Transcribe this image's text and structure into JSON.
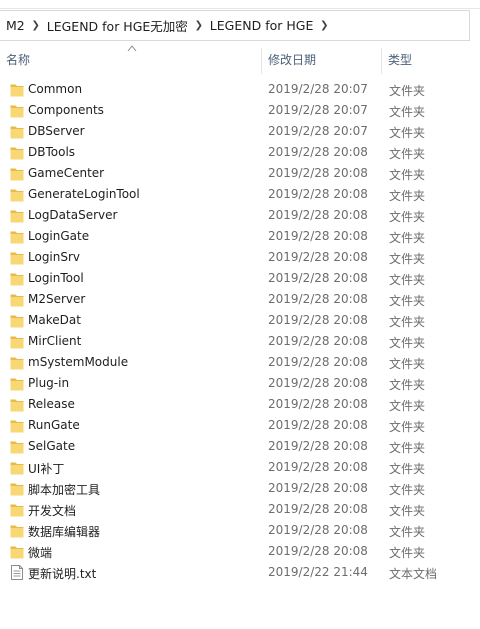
{
  "breadcrumb": {
    "items": [
      "M2",
      "LEGEND for HGE无加密",
      "LEGEND for HGE"
    ]
  },
  "columns": {
    "name": "名称",
    "date": "修改日期",
    "type": "类型"
  },
  "colors": {
    "folder_body": "#f8d775",
    "folder_tab": "#e9b94a",
    "header_text": "#4c607a",
    "secondary_text": "#6d6d6d"
  },
  "files": [
    {
      "name": "Common",
      "date": "2019/2/28 20:07",
      "type": "文件夹",
      "icon": "folder-icon"
    },
    {
      "name": "Components",
      "date": "2019/2/28 20:07",
      "type": "文件夹",
      "icon": "folder-icon"
    },
    {
      "name": "DBServer",
      "date": "2019/2/28 20:07",
      "type": "文件夹",
      "icon": "folder-icon"
    },
    {
      "name": "DBTools",
      "date": "2019/2/28 20:08",
      "type": "文件夹",
      "icon": "folder-icon"
    },
    {
      "name": "GameCenter",
      "date": "2019/2/28 20:08",
      "type": "文件夹",
      "icon": "folder-icon"
    },
    {
      "name": "GenerateLoginTool",
      "date": "2019/2/28 20:08",
      "type": "文件夹",
      "icon": "folder-icon"
    },
    {
      "name": "LogDataServer",
      "date": "2019/2/28 20:08",
      "type": "文件夹",
      "icon": "folder-icon"
    },
    {
      "name": "LoginGate",
      "date": "2019/2/28 20:08",
      "type": "文件夹",
      "icon": "folder-icon"
    },
    {
      "name": "LoginSrv",
      "date": "2019/2/28 20:08",
      "type": "文件夹",
      "icon": "folder-icon"
    },
    {
      "name": "LoginTool",
      "date": "2019/2/28 20:08",
      "type": "文件夹",
      "icon": "folder-icon"
    },
    {
      "name": "M2Server",
      "date": "2019/2/28 20:08",
      "type": "文件夹",
      "icon": "folder-icon"
    },
    {
      "name": "MakeDat",
      "date": "2019/2/28 20:08",
      "type": "文件夹",
      "icon": "folder-icon"
    },
    {
      "name": "MirClient",
      "date": "2019/2/28 20:08",
      "type": "文件夹",
      "icon": "folder-icon"
    },
    {
      "name": "mSystemModule",
      "date": "2019/2/28 20:08",
      "type": "文件夹",
      "icon": "folder-icon"
    },
    {
      "name": "Plug-in",
      "date": "2019/2/28 20:08",
      "type": "文件夹",
      "icon": "folder-icon"
    },
    {
      "name": "Release",
      "date": "2019/2/28 20:08",
      "type": "文件夹",
      "icon": "folder-icon"
    },
    {
      "name": "RunGate",
      "date": "2019/2/28 20:08",
      "type": "文件夹",
      "icon": "folder-icon"
    },
    {
      "name": "SelGate",
      "date": "2019/2/28 20:08",
      "type": "文件夹",
      "icon": "folder-icon"
    },
    {
      "name": "UI补丁",
      "date": "2019/2/28 20:08",
      "type": "文件夹",
      "icon": "folder-icon"
    },
    {
      "name": "脚本加密工具",
      "date": "2019/2/28 20:08",
      "type": "文件夹",
      "icon": "folder-icon"
    },
    {
      "name": "开发文档",
      "date": "2019/2/28 20:08",
      "type": "文件夹",
      "icon": "folder-icon"
    },
    {
      "name": "数据库编辑器",
      "date": "2019/2/28 20:08",
      "type": "文件夹",
      "icon": "folder-icon"
    },
    {
      "name": "微端",
      "date": "2019/2/28 20:08",
      "type": "文件夹",
      "icon": "folder-icon"
    },
    {
      "name": "更新说明.txt",
      "date": "2019/2/22 21:44",
      "type": "文本文档",
      "icon": "text-file-icon"
    }
  ]
}
